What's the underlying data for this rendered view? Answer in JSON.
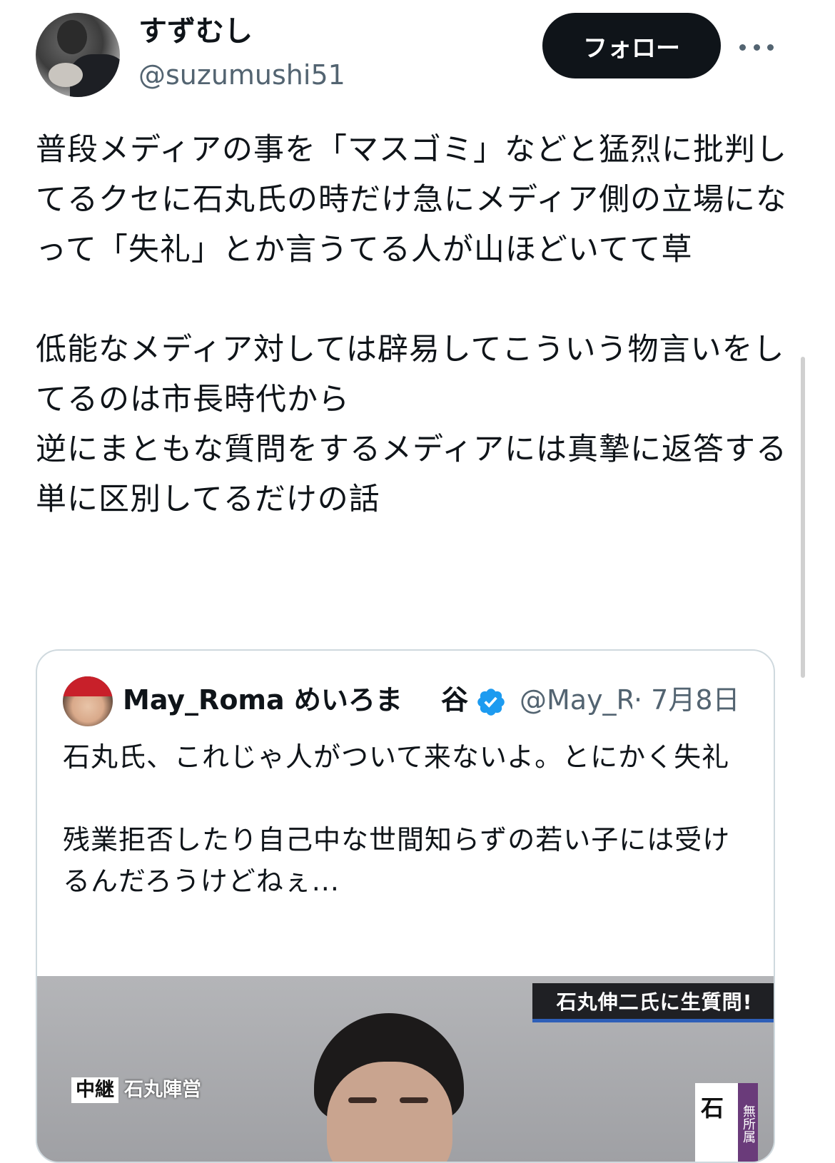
{
  "header": {
    "display_name": "すずむし",
    "handle": "@suzumushi51",
    "follow_label": "フォロー"
  },
  "tweet": {
    "text": "普段メディアの事を「マスゴミ」などと猛烈に批判してるクセに石丸氏の時だけ急にメディア側の立場になって「失礼」とか言うてる人が山ほどいてて草\n\n低能なメディア対しては辟易してこういう物言いをしてるのは市長時代から\n逆にまともな質問をするメディアには真摯に返答する\n単に区別してるだけの話"
  },
  "quote": {
    "name": "May_Roma めいろま",
    "name_suffix": "谷",
    "handle": "@May_R",
    "date": "· 7月8日",
    "text": "石丸氏、これじゃ人がついて来ないよ。とにかく失礼\n\n残業拒否したり自己中な世間知らずの若い子には受けるんだろうけどねぇ...",
    "media": {
      "caption": "石丸伸二氏に生質問!",
      "live_label": "中継",
      "live_text": "石丸陣営",
      "plate_text": "石",
      "plate_side_text": "無所属"
    }
  },
  "colors": {
    "primary_text": "#0f1419",
    "secondary_text": "#536471",
    "follow_bg": "#0f1419",
    "verified": "#1d9bf0",
    "border": "#cfd9de"
  },
  "icons": [
    "more-icon",
    "verified-badge-icon"
  ]
}
